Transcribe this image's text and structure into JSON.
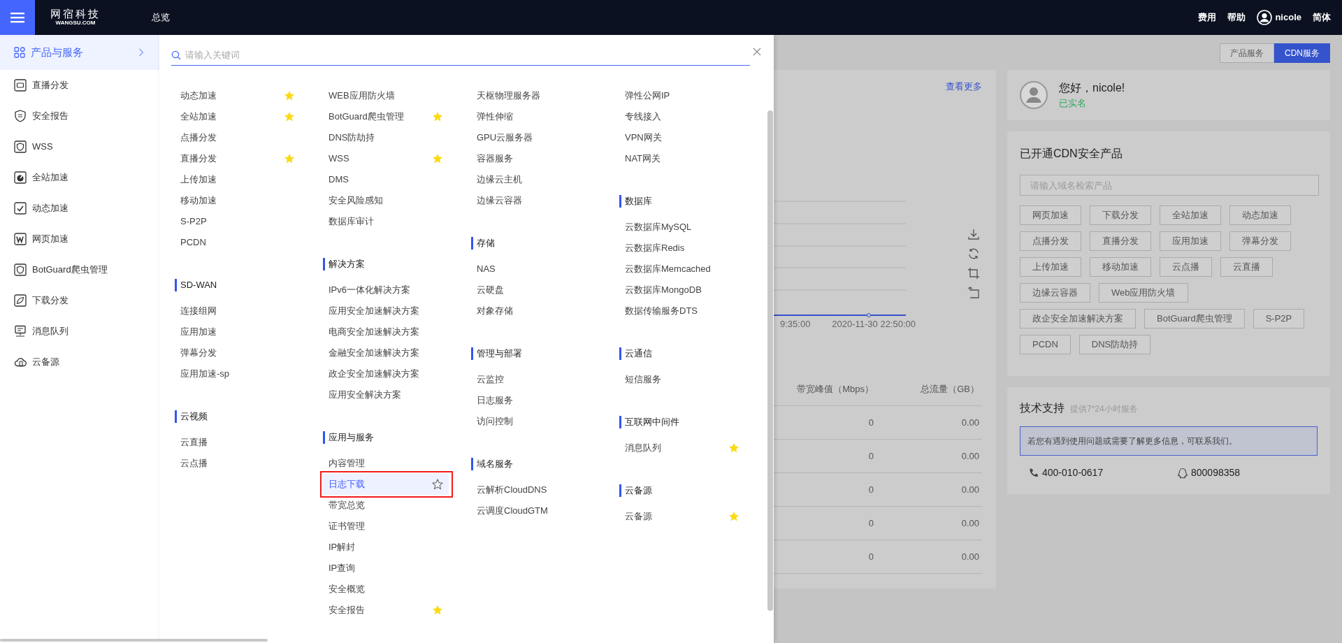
{
  "topbar": {
    "logo_cn": "网宿科技",
    "logo_en": "WANGSU.COM",
    "nav": "总览",
    "links": [
      "费用",
      "帮助"
    ],
    "user": "nicole",
    "language": "简体"
  },
  "sidebar": {
    "header": "产品与服务",
    "items": [
      "直播分发",
      "安全报告",
      "WSS",
      "全站加速",
      "动态加速",
      "网页加速",
      "BotGuard爬虫管理",
      "下载分发",
      "消息队列",
      "云备源"
    ]
  },
  "menu": {
    "search_placeholder": "请输入关键词",
    "columns": [
      {
        "groups": [
          {
            "items": [
              {
                "label": "动态加速",
                "starred": true,
                "highlighted": false
              },
              {
                "label": "全站加速",
                "starred": true,
                "highlighted": false
              },
              {
                "label": "点播分发",
                "starred": false,
                "highlighted": false
              },
              {
                "label": "直播分发",
                "starred": true,
                "highlighted": false
              },
              {
                "label": "上传加速",
                "starred": false,
                "highlighted": false
              },
              {
                "label": "移动加速",
                "starred": false,
                "highlighted": false
              },
              {
                "label": "S-P2P",
                "starred": false,
                "highlighted": false
              },
              {
                "label": "PCDN",
                "starred": false,
                "highlighted": false
              }
            ]
          },
          {
            "title": "SD-WAN",
            "items": [
              {
                "label": "连接组网",
                "starred": false,
                "highlighted": false
              },
              {
                "label": "应用加速",
                "starred": false,
                "highlighted": false
              },
              {
                "label": "弹幕分发",
                "starred": false,
                "highlighted": false
              },
              {
                "label": "应用加速-sp",
                "starred": false,
                "highlighted": false
              }
            ]
          },
          {
            "title": "云视频",
            "items": [
              {
                "label": "云直播",
                "starred": false,
                "highlighted": false
              },
              {
                "label": "云点播",
                "starred": false,
                "highlighted": false
              }
            ]
          }
        ]
      },
      {
        "groups": [
          {
            "items": [
              {
                "label": "WEB应用防火墙",
                "starred": false,
                "highlighted": false
              },
              {
                "label": "BotGuard爬虫管理",
                "starred": true,
                "highlighted": false
              },
              {
                "label": "DNS防劫持",
                "starred": false,
                "highlighted": false
              },
              {
                "label": "WSS",
                "starred": true,
                "highlighted": false
              },
              {
                "label": "DMS",
                "starred": false,
                "highlighted": false
              },
              {
                "label": "安全风险感知",
                "starred": false,
                "highlighted": false
              },
              {
                "label": "数据库审计",
                "starred": false,
                "highlighted": false
              }
            ]
          },
          {
            "title": "解决方案",
            "items": [
              {
                "label": "IPv6一体化解决方案",
                "starred": false,
                "highlighted": false
              },
              {
                "label": "应用安全加速解决方案",
                "starred": false,
                "highlighted": false
              },
              {
                "label": "电商安全加速解决方案",
                "starred": false,
                "highlighted": false
              },
              {
                "label": "金融安全加速解决方案",
                "starred": false,
                "highlighted": false
              },
              {
                "label": "政企安全加速解决方案",
                "starred": false,
                "highlighted": false
              },
              {
                "label": "应用安全解决方案",
                "starred": false,
                "highlighted": false
              }
            ]
          },
          {
            "title": "应用与服务",
            "items": [
              {
                "label": "内容管理",
                "starred": false,
                "highlighted": false
              },
              {
                "label": "日志下载",
                "starred": false,
                "highlighted": true
              },
              {
                "label": "带宽总览",
                "starred": false,
                "highlighted": false
              },
              {
                "label": "证书管理",
                "starred": false,
                "highlighted": false
              },
              {
                "label": "IP解封",
                "starred": false,
                "highlighted": false
              },
              {
                "label": "IP查询",
                "starred": false,
                "highlighted": false
              },
              {
                "label": "安全概览",
                "starred": false,
                "highlighted": false
              },
              {
                "label": "安全报告",
                "starred": true,
                "highlighted": false
              }
            ]
          }
        ]
      },
      {
        "groups": [
          {
            "items": [
              {
                "label": "天枢物理服务器",
                "starred": false,
                "highlighted": false
              },
              {
                "label": "弹性伸缩",
                "starred": false,
                "highlighted": false
              },
              {
                "label": "GPU云服务器",
                "starred": false,
                "highlighted": false
              },
              {
                "label": "容器服务",
                "starred": false,
                "highlighted": false
              },
              {
                "label": "边缘云主机",
                "starred": false,
                "highlighted": false
              },
              {
                "label": "边缘云容器",
                "starred": false,
                "highlighted": false
              }
            ]
          },
          {
            "title": "存储",
            "items": [
              {
                "label": "NAS",
                "starred": false,
                "highlighted": false
              },
              {
                "label": "云硬盘",
                "starred": false,
                "highlighted": false
              },
              {
                "label": "对象存储",
                "starred": false,
                "highlighted": false
              }
            ]
          },
          {
            "title": "管理与部署",
            "items": [
              {
                "label": "云监控",
                "starred": false,
                "highlighted": false
              },
              {
                "label": "日志服务",
                "starred": false,
                "highlighted": false
              },
              {
                "label": "访问控制",
                "starred": false,
                "highlighted": false
              }
            ]
          },
          {
            "title": "域名服务",
            "items": [
              {
                "label": "云解析CloudDNS",
                "starred": false,
                "highlighted": false
              },
              {
                "label": "云调度CloudGTM",
                "starred": false,
                "highlighted": false
              }
            ]
          }
        ]
      },
      {
        "groups": [
          {
            "items": [
              {
                "label": "弹性公网IP",
                "starred": false,
                "highlighted": false
              },
              {
                "label": "专线接入",
                "starred": false,
                "highlighted": false
              },
              {
                "label": "VPN网关",
                "starred": false,
                "highlighted": false
              },
              {
                "label": "NAT网关",
                "starred": false,
                "highlighted": false
              }
            ]
          },
          {
            "title": "数据库",
            "items": [
              {
                "label": "云数据库MySQL",
                "starred": false,
                "highlighted": false
              },
              {
                "label": "云数据库Redis",
                "starred": false,
                "highlighted": false
              },
              {
                "label": "云数据库Memcached",
                "starred": false,
                "highlighted": false
              },
              {
                "label": "云数据库MongoDB",
                "starred": false,
                "highlighted": false
              },
              {
                "label": "数据传输服务DTS",
                "starred": false,
                "highlighted": false
              }
            ]
          },
          {
            "title": "云通信",
            "items": [
              {
                "label": "短信服务",
                "starred": false,
                "highlighted": false
              }
            ]
          },
          {
            "title": "互联网中间件",
            "items": [
              {
                "label": "消息队列",
                "starred": true,
                "highlighted": false
              }
            ]
          },
          {
            "title": "云备源",
            "items": [
              {
                "label": "云备源",
                "starred": true,
                "highlighted": false
              }
            ]
          }
        ]
      }
    ]
  },
  "view_tabs": [
    {
      "label": "产品服务",
      "selected": false
    },
    {
      "label": "CDN服务",
      "selected": true
    }
  ],
  "overview": {
    "link": "查看更多",
    "x_labels": [
      "9:35:00",
      "2020-11-30 22:50:00"
    ],
    "table": {
      "columns": [
        "带宽峰值（Mbps）",
        "总流量（GB）"
      ],
      "rows": [
        [
          "0",
          "0.00"
        ],
        [
          "0",
          "0.00"
        ],
        [
          "0",
          "0.00"
        ],
        [
          "0",
          "0.00"
        ],
        [
          "0",
          "0.00"
        ]
      ]
    }
  },
  "greeting": {
    "title": "您好，nicole!",
    "status": "已实名"
  },
  "products": {
    "title": "已开通CDN安全产品",
    "search_placeholder": "请输入域名检索产品",
    "tag_rows": [
      [
        "网页加速",
        "下载分发",
        "全站加速",
        "动态加速"
      ],
      [
        "点播分发",
        "直播分发",
        "应用加速",
        "弹幕分发"
      ],
      [
        "上传加速",
        "移动加速",
        "云点播",
        "云直播"
      ],
      [
        "边缘云容器",
        "Web应用防火墙"
      ],
      [
        "政企安全加速解决方案",
        "BotGuard爬虫管理",
        "S-P2P"
      ],
      [
        "PCDN",
        "DNS防劫持"
      ]
    ]
  },
  "support": {
    "title": "技术支持",
    "subtitle": "提供7*24小时服务",
    "notice": "若您有遇到使用问题或需要了解更多信息，可联系我们。",
    "phone": "400-010-0617",
    "qq": "800098358"
  }
}
